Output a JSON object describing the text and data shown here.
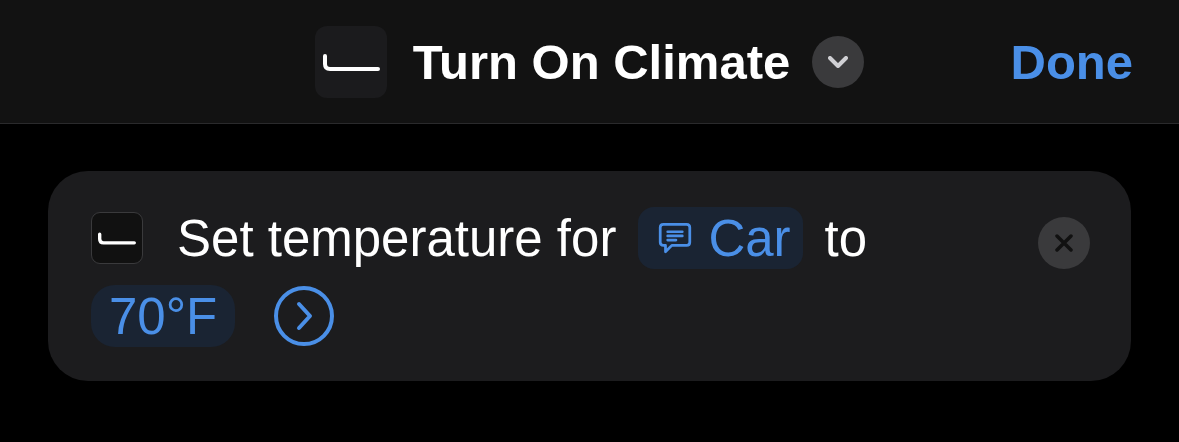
{
  "header": {
    "title": "Turn On Climate",
    "done_label": "Done"
  },
  "action": {
    "parts": [
      {
        "kind": "text",
        "text": "Set temperature for"
      },
      {
        "kind": "variable",
        "text": "Car"
      },
      {
        "kind": "text",
        "text": "to"
      },
      {
        "kind": "value",
        "text": "70°F"
      }
    ]
  }
}
